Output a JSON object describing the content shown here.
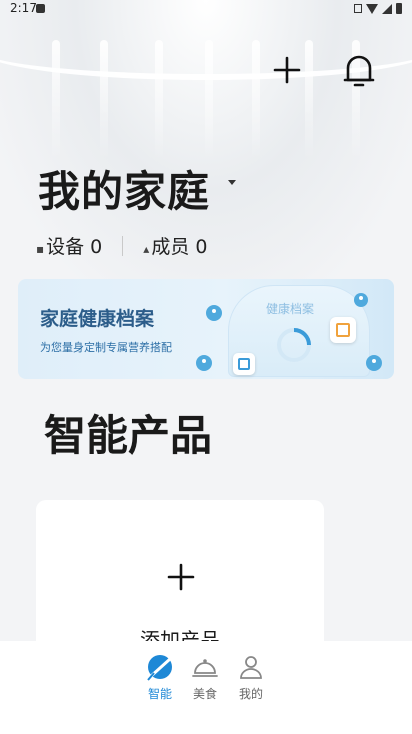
{
  "status_bar": {
    "time": "2:17"
  },
  "header": {
    "family_name": "我的家庭"
  },
  "stats": {
    "devices_label": "设备 0",
    "members_label": "成员 0"
  },
  "banner": {
    "title": "家庭健康档案",
    "subtitle": "为您量身定制专属营养搭配",
    "card_label": "健康档案"
  },
  "products": {
    "section_title": "智能产品",
    "add_label": "添加产品"
  },
  "tabbar": {
    "items": [
      {
        "label": "智能",
        "icon": "smart-leaf-icon",
        "active": true
      },
      {
        "label": "美食",
        "icon": "food-cloche-icon",
        "active": false
      },
      {
        "label": "我的",
        "icon": "profile-icon",
        "active": false
      }
    ]
  },
  "colors": {
    "accent": "#1e88d6",
    "banner_title": "#2c5d8a",
    "bubble": "#4fa9dd"
  }
}
